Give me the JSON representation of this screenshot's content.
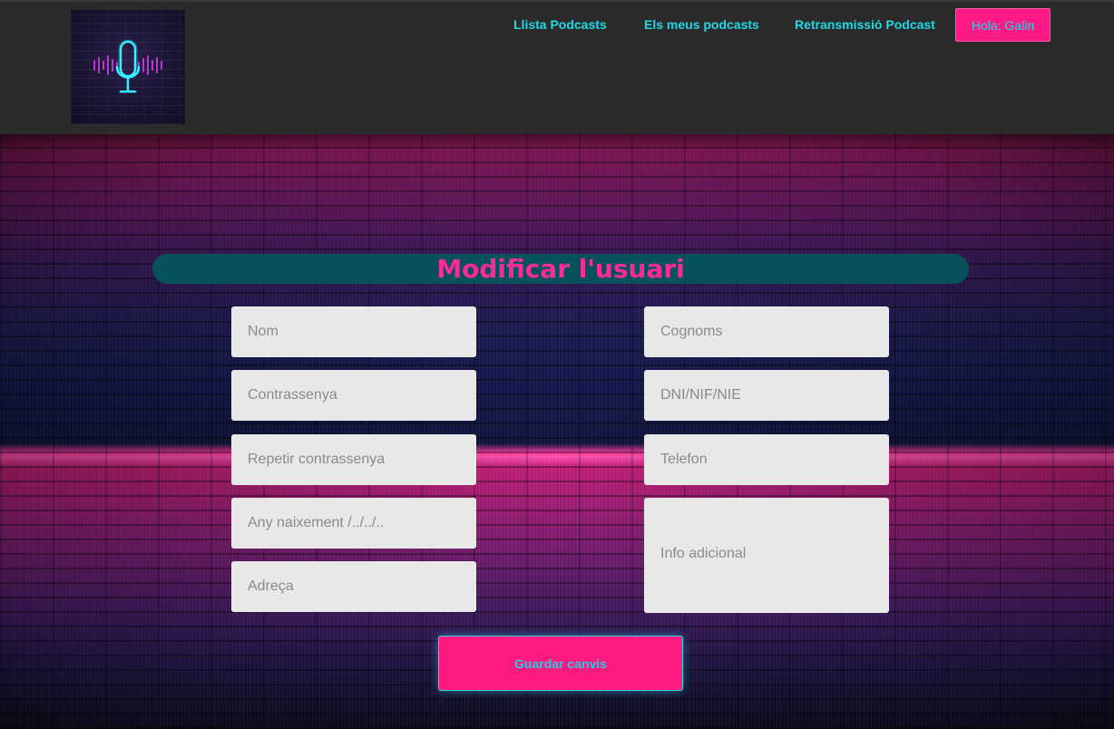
{
  "header": {
    "logo_icon": "microphone-soundwave-icon",
    "nav": [
      {
        "label": "Llista Podcasts"
      },
      {
        "label": "Els meus podcasts"
      },
      {
        "label": "Retransmissió Podcast"
      }
    ],
    "greeting": "Hola; Galin"
  },
  "form": {
    "title": "Modificar l'usuari",
    "fields": {
      "nom": {
        "placeholder": "Nom",
        "value": ""
      },
      "cognoms": {
        "placeholder": "Cognoms",
        "value": ""
      },
      "contrassenya": {
        "placeholder": "Contrassenya",
        "value": ""
      },
      "dni": {
        "placeholder": "DNI/NIF/NIE",
        "value": ""
      },
      "repetir_contrassenya": {
        "placeholder": "Repetir contrassenya",
        "value": ""
      },
      "telefon": {
        "placeholder": "Telefon",
        "value": ""
      },
      "any_naixement": {
        "placeholder": "Any naixement /../../..",
        "value": ""
      },
      "info_adicional": {
        "placeholder": "Info adicional",
        "value": ""
      },
      "adreca": {
        "placeholder": "Adreça",
        "value": ""
      }
    },
    "submit_label": "Guardar canvis"
  },
  "colors": {
    "header_bg": "#2b2b2b",
    "nav_text": "#1ed8e6",
    "accent_pink": "#ff1a86",
    "title_bar": "#06525a",
    "field_bg": "#e8e8e8"
  }
}
